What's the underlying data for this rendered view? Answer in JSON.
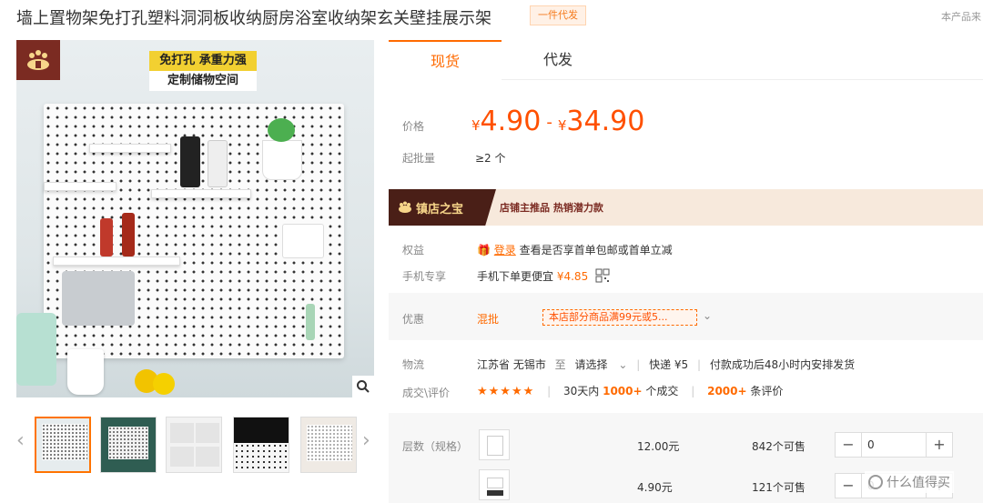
{
  "header": {
    "title": "墙上置物架免打孔塑料洞洞板收纳厨房浴室收纳架玄关壁挂展示架",
    "badge": "一件代发",
    "right_text": "本产品来"
  },
  "gallery": {
    "promo_line1": "免打孔 承重力强",
    "promo_line2": "定制储物空间",
    "thumbnail_count": 5
  },
  "tabs": [
    {
      "label": "现货"
    },
    {
      "label": "代发"
    }
  ],
  "price": {
    "label": "价格",
    "currency": "¥",
    "min": "4.90",
    "max": "34.90",
    "dash": "-"
  },
  "moq": {
    "label": "起批量",
    "value": "≥2 个"
  },
  "banner": {
    "title": "镇店之宝",
    "text": "店铺主推品  热销潜力款"
  },
  "benefits": {
    "label": "权益",
    "login": "登录",
    "text": "查看是否享首单包邮或首单立减"
  },
  "mobile": {
    "label": "手机专享",
    "text": "手机下单更便宜",
    "price": "¥4.85"
  },
  "discount": {
    "label": "优惠",
    "mix": "混批",
    "tag": "本店部分商品满99元或5..."
  },
  "logistics": {
    "label": "物流",
    "origin": "江苏省 无锡市",
    "to": "至",
    "destination": "请选择",
    "express": "快递 ¥5",
    "shipping_note": "付款成功后48小时内安排发货"
  },
  "reviews": {
    "label": "成交\\评价",
    "stars": "★★★★★",
    "deal_prefix": "30天内",
    "deal_count": "1000+",
    "deal_suffix": "个成交",
    "review_count": "2000+",
    "review_suffix": "条评价"
  },
  "sku": {
    "label": "层数（规格）",
    "rows": [
      {
        "price": "12.00元",
        "stock": "842个可售",
        "qty": "0"
      },
      {
        "price": "4.90元",
        "stock": "121个可售",
        "qty": "0"
      }
    ]
  },
  "watermark": {
    "text": "什么值得买"
  }
}
